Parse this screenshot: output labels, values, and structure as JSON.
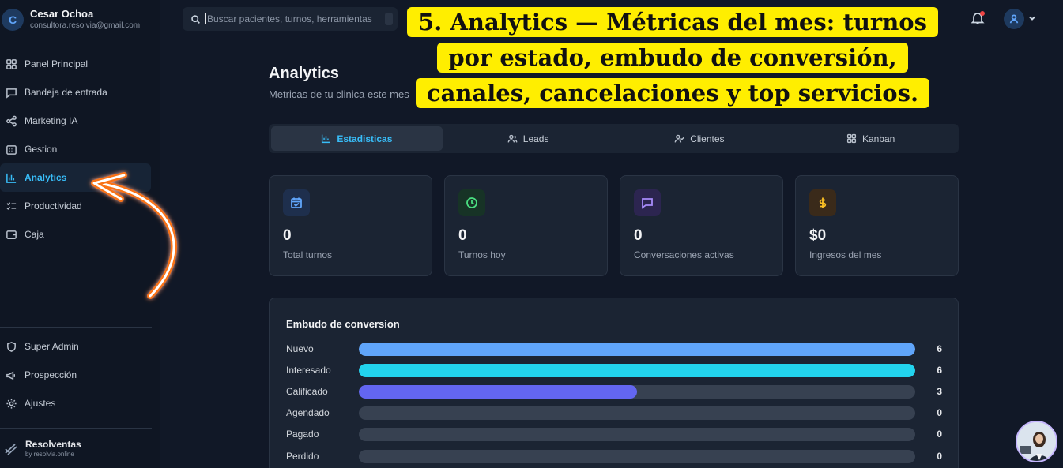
{
  "user": {
    "initial": "C",
    "name": "Cesar Ochoa",
    "email": "consultora.resolvia@gmail.com"
  },
  "sidebar": {
    "items": [
      {
        "label": "Panel Principal",
        "icon": "grid-icon"
      },
      {
        "label": "Bandeja de entrada",
        "icon": "message-square-icon"
      },
      {
        "label": "Marketing IA",
        "icon": "share-icon"
      },
      {
        "label": "Gestion",
        "icon": "calendar-days-icon"
      },
      {
        "label": "Analytics",
        "icon": "bar-chart-icon",
        "active": true
      },
      {
        "label": "Productividad",
        "icon": "list-checks-icon"
      },
      {
        "label": "Caja",
        "icon": "wallet-icon"
      }
    ],
    "bottom_items": [
      {
        "label": "Super Admin",
        "icon": "shield-icon"
      },
      {
        "label": "Prospección",
        "icon": "megaphone-icon"
      },
      {
        "label": "Ajustes",
        "icon": "gear-icon"
      }
    ],
    "brand": {
      "name": "Resolventas",
      "sub": "by resolvia.online"
    }
  },
  "topbar": {
    "search_placeholder": "Buscar pacientes, turnos, herramientas"
  },
  "page": {
    "title": "Analytics",
    "subtitle": "Metricas de tu clinica este mes"
  },
  "tabs": [
    {
      "label": "Estadisticas",
      "icon": "bar-chart-icon",
      "active": true
    },
    {
      "label": "Leads",
      "icon": "users-icon"
    },
    {
      "label": "Clientes",
      "icon": "user-check-icon"
    },
    {
      "label": "Kanban",
      "icon": "grid-icon"
    }
  ],
  "stats": [
    {
      "value": "0",
      "label": "Total turnos",
      "icon": "calendar-check-icon",
      "color": "#60a5fa",
      "bg": "#1e2f4d"
    },
    {
      "value": "0",
      "label": "Turnos hoy",
      "icon": "clock-icon",
      "color": "#4ade80",
      "bg": "#173326"
    },
    {
      "value": "0",
      "label": "Conversaciones activas",
      "icon": "message-square-icon",
      "color": "#a78bfa",
      "bg": "#2c2550"
    },
    {
      "value": "$0",
      "label": "Ingresos del mes",
      "icon": "dollar-icon",
      "color": "#fbbf24",
      "bg": "#3a2a1a"
    }
  ],
  "funnel": {
    "title": "Embudo de conversion",
    "max": 6,
    "rows": [
      {
        "label": "Nuevo",
        "value": 6,
        "color": "#60a5fa"
      },
      {
        "label": "Interesado",
        "value": 6,
        "color": "#22d3ee"
      },
      {
        "label": "Calificado",
        "value": 3,
        "color": "#6366f1"
      },
      {
        "label": "Agendado",
        "value": 0,
        "color": "#6366f1"
      },
      {
        "label": "Pagado",
        "value": 0,
        "color": "#6366f1"
      },
      {
        "label": "Perdido",
        "value": 0,
        "color": "#6366f1"
      }
    ]
  },
  "annotation": {
    "text": "5. Analytics — Métricas del mes: turnos por estado, embudo de conversión, canales, cancelaciones y top servicios."
  }
}
